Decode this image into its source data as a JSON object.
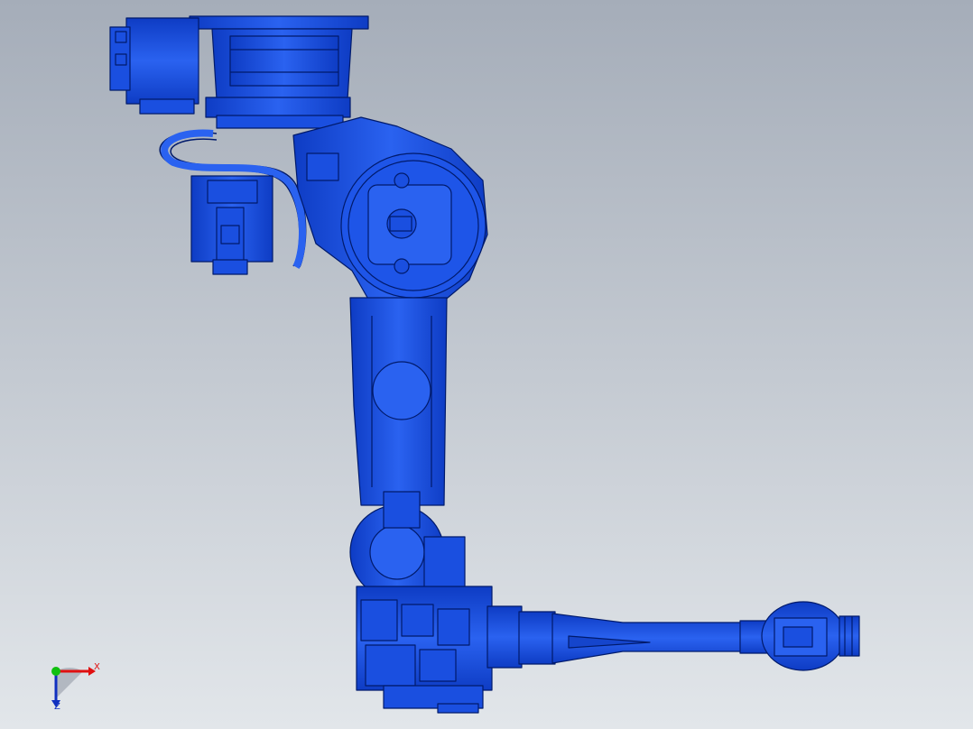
{
  "viewport": {
    "background_top": "#a5adb9",
    "background_bottom": "#e2e6ea"
  },
  "model": {
    "part_color": "#1a4fe0",
    "edge_color": "#001a6b"
  },
  "triad": {
    "x_label": "X",
    "z_label": "Z",
    "x_color": "#e01010",
    "y_color": "#10c010",
    "z_color": "#1030c0"
  }
}
